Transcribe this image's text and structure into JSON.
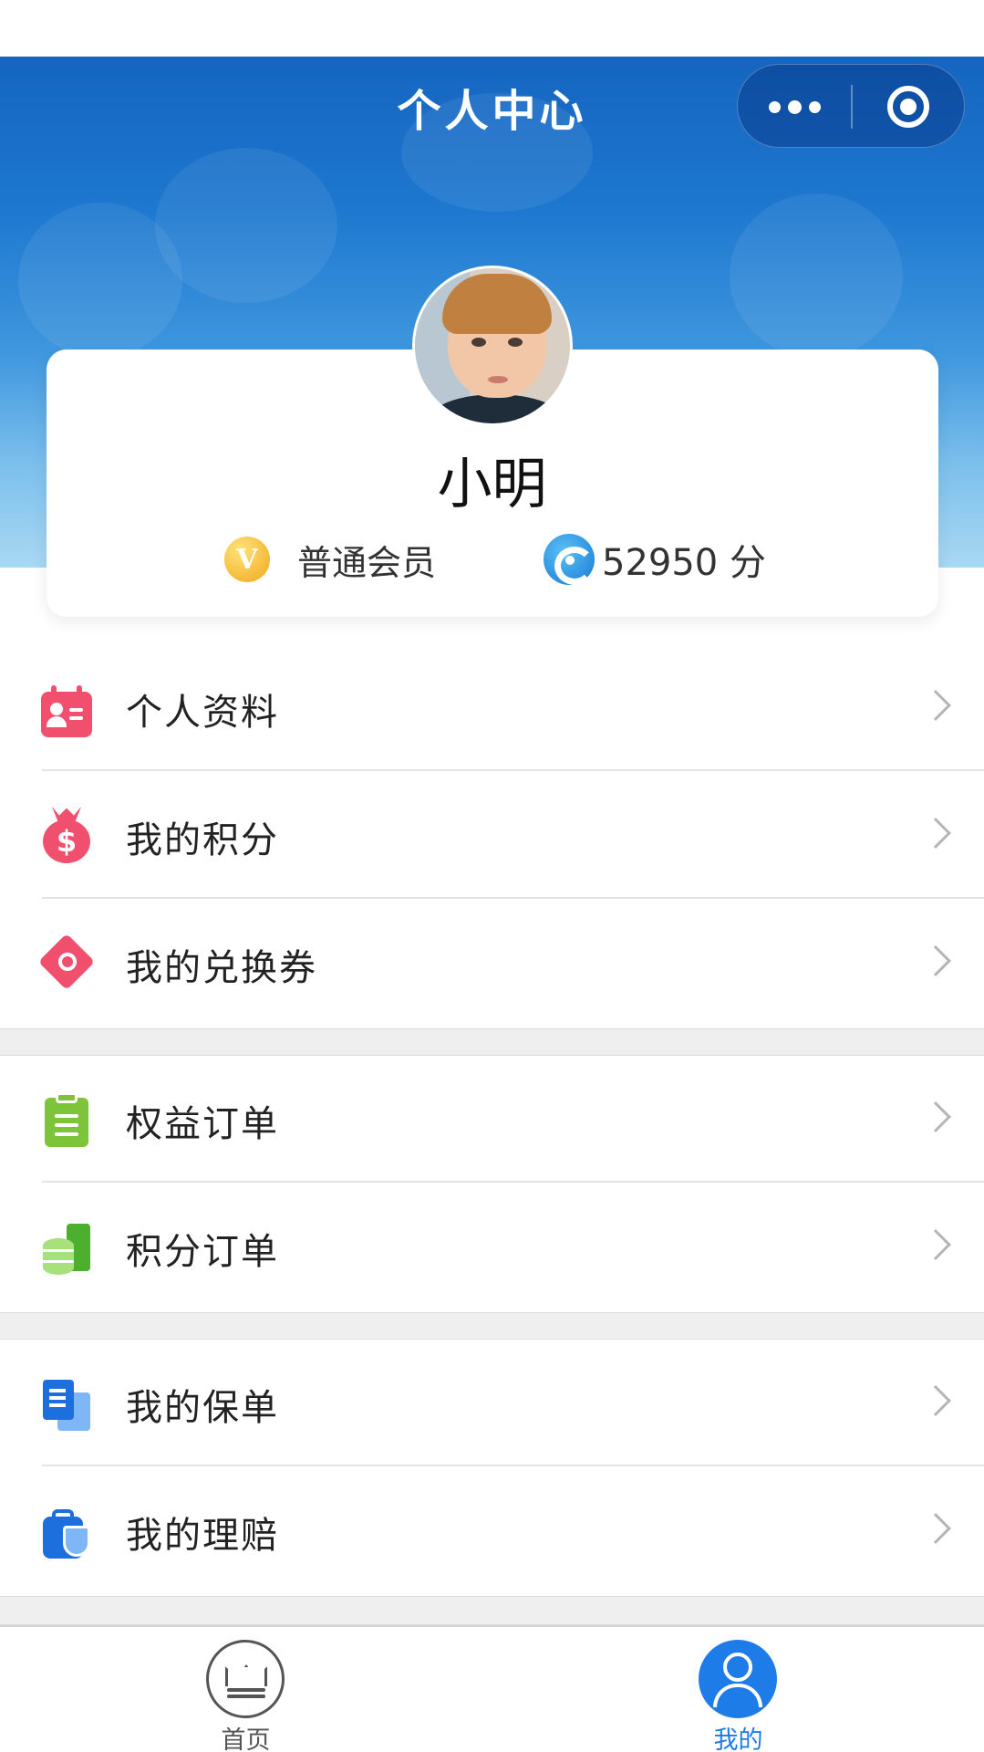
{
  "header": {
    "title": "个人中心",
    "more_icon": "more-dots-icon",
    "close_icon": "target-close-icon"
  },
  "profile": {
    "name": "小明",
    "member_level": "普通会员",
    "member_icon": "v-badge-icon",
    "points": "52950 分",
    "points_icon": "points-coin-icon"
  },
  "menu": {
    "group1": [
      {
        "label": "个人资料",
        "icon": "profile-card-icon"
      },
      {
        "label": "我的积分",
        "icon": "money-bag-icon"
      },
      {
        "label": "我的兑换券",
        "icon": "coupon-tag-icon"
      }
    ],
    "group2": [
      {
        "label": "权益订单",
        "icon": "clipboard-icon"
      },
      {
        "label": "积分订单",
        "icon": "coins-order-icon"
      }
    ],
    "group3": [
      {
        "label": "我的保单",
        "icon": "policy-doc-icon"
      },
      {
        "label": "我的理赔",
        "icon": "claim-case-icon"
      }
    ]
  },
  "tabbar": {
    "home_label": "首页",
    "me_label": "我的",
    "active_color": "#1e7ce8",
    "inactive_color": "#555555"
  },
  "colors": {
    "header_blue": "#1565c0",
    "accent_pink": "#f0506e",
    "accent_green": "#7dc43b",
    "accent_blue": "#1e6fde"
  }
}
